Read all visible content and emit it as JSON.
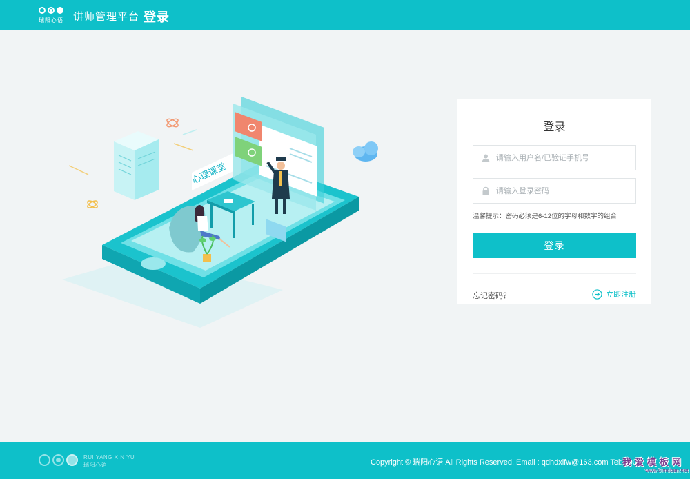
{
  "header": {
    "logo_text": "瑞阳心语",
    "platform_name": "讲师管理平台",
    "page_title": "登录"
  },
  "illustration": {
    "sign_text": "心理课堂"
  },
  "login": {
    "title": "登录",
    "username_placeholder": "请输入用户名/已验证手机号",
    "password_placeholder": "请输入登录密码",
    "hint": "温馨提示：密码必须是6-12位的字母和数字的组合",
    "submit_label": "登录",
    "forgot_label": "忘记密码？",
    "register_label": "立即注册"
  },
  "footer": {
    "brand_en": "RUI YANG XIN YU",
    "brand_cn": "瑞阳心语",
    "copyright": "Copyright © 瑞阳心语 All Rights Reserved. Email : qdhdxlfw@163.com Tel: 400-1"
  },
  "watermark": {
    "text": "我爱模板网",
    "url": "www.5imoban.net"
  },
  "colors": {
    "accent": "#0ec0c9",
    "background": "#f1f4f5"
  }
}
